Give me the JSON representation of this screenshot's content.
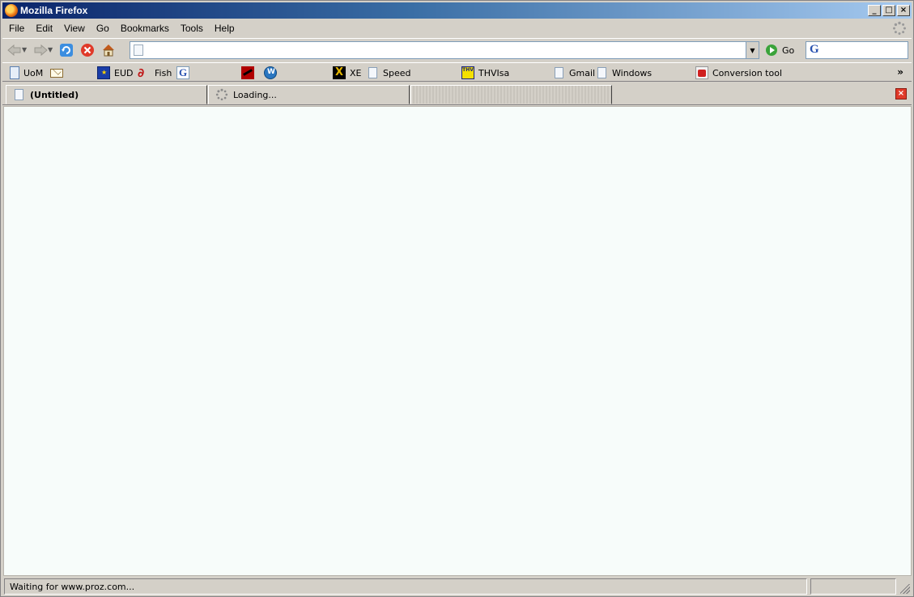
{
  "window": {
    "title": "Mozilla Firefox",
    "controls": [
      "minimize",
      "maximize",
      "close"
    ]
  },
  "menu": [
    "File",
    "Edit",
    "View",
    "Go",
    "Bookmarks",
    "Tools",
    "Help"
  ],
  "navigation": {
    "url_value": "",
    "go_label": "Go",
    "search_value": "",
    "search_engine_glyph": "G"
  },
  "bookmarks": [
    {
      "label": "UoM",
      "icon": "uom-icon"
    },
    {
      "label": "",
      "icon": "mail-icon"
    },
    {
      "label": "EUD",
      "icon": "eu-flag-icon"
    },
    {
      "label": "Fish",
      "icon": "fish-icon"
    },
    {
      "label": "",
      "icon": "google-icon"
    },
    {
      "label": "",
      "icon": "acrobat-icon"
    },
    {
      "label": "",
      "icon": "wordpress-icon"
    },
    {
      "label": "XE",
      "icon": "xe-icon"
    },
    {
      "label": "Speed",
      "icon": "page-icon"
    },
    {
      "label": "THVIsa",
      "icon": "thv-icon"
    },
    {
      "label": "Gmail",
      "icon": "page-icon"
    },
    {
      "label": "Windows",
      "icon": "page-icon"
    },
    {
      "label": "Conversion tool",
      "icon": "conversion-icon"
    }
  ],
  "tabs": [
    {
      "label": "(Untitled)",
      "active": true
    },
    {
      "label": "Loading...",
      "active": false
    },
    {
      "label": "",
      "active": false
    }
  ],
  "status": {
    "text": "Waiting for www.proz.com..."
  }
}
